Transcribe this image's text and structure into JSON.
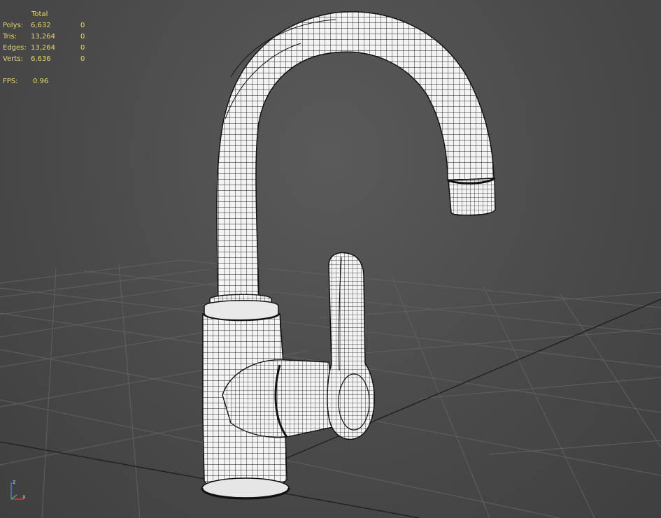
{
  "viewport": {
    "background": "#4d4d4d",
    "grid_color": "#5f5f5f",
    "axis_color": "#1e1e1e",
    "wire_color": "#111111",
    "surface_color": "#f4f4f4"
  },
  "stats": {
    "header": "Total",
    "rows": [
      {
        "label": "Polys:",
        "total": "6,632",
        "selected": "0"
      },
      {
        "label": "Tris:",
        "total": "13,264",
        "selected": "0"
      },
      {
        "label": "Edges:",
        "total": "13,264",
        "selected": "0"
      },
      {
        "label": "Verts:",
        "total": "6,636",
        "selected": "0"
      }
    ],
    "fps_label": "FPS:",
    "fps_value": "0.96",
    "text_color": "#e8d76a"
  },
  "gizmo": {
    "z_label": "z",
    "x_label": "x",
    "z_color": "#4a7ae0",
    "x_color": "#d23a3a",
    "y_color": "#3fb14a"
  },
  "model": {
    "icon": "faucet-mesh-icon"
  }
}
